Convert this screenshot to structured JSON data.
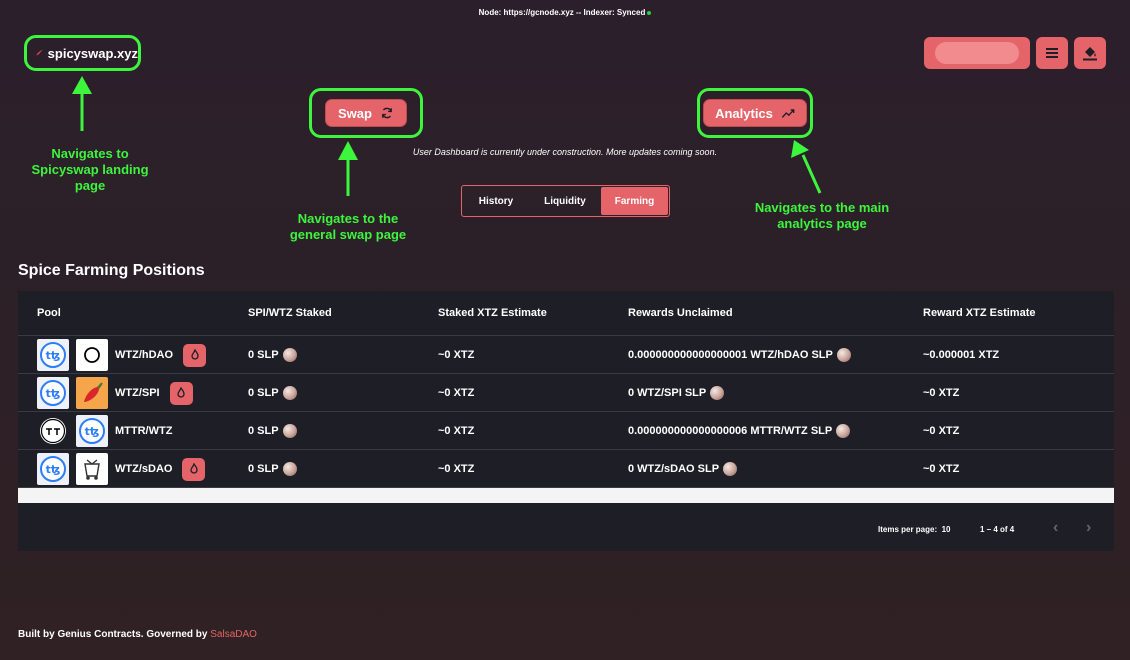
{
  "status_bar": {
    "node_text": "Node: https://gcnode.xyz  --  Indexer: Synced"
  },
  "header": {
    "logo_text": "spicyswap.xyz"
  },
  "nav": {
    "swap_label": "Swap",
    "analytics_label": "Analytics"
  },
  "notice": "User Dashboard is currently under construction. More updates coming soon.",
  "tabs": [
    {
      "label": "History"
    },
    {
      "label": "Liquidity"
    },
    {
      "label": "Farming",
      "active": true
    }
  ],
  "annotations": {
    "logo": "Navigates to Spicyswap landing page",
    "swap": "Navigates to the general swap page",
    "analytics": "Navigates to the main analytics page"
  },
  "section_title": "Spice Farming Positions",
  "table": {
    "headers": [
      "Pool",
      "SPI/WTZ Staked",
      "Staked XTZ Estimate",
      "Rewards Unclaimed",
      "Reward XTZ Estimate"
    ],
    "rows": [
      {
        "pool": "WTZ/hDAO",
        "token_a": "tezos-icon",
        "token_b": "hdao-icon",
        "staked": "0 SLP",
        "xtz_estimate": "~0 XTZ",
        "rewards": "0.000000000000000001 WTZ/hDAO SLP",
        "reward_xtz": "~0.000001 XTZ"
      },
      {
        "pool": "WTZ/SPI",
        "token_a": "tezos-icon",
        "token_b": "chili-icon",
        "staked": "0 SLP",
        "xtz_estimate": "~0 XTZ",
        "rewards": "0 WTZ/SPI SLP",
        "reward_xtz": "~0 XTZ"
      },
      {
        "pool": "MTTR/WTZ",
        "token_a": "mttr-icon",
        "token_b": "tezos-icon",
        "staked": "0 SLP",
        "xtz_estimate": "~0 XTZ",
        "rewards": "0.000000000000000006 MTTR/WTZ SLP",
        "reward_xtz": "~0 XTZ"
      },
      {
        "pool": "WTZ/sDAO",
        "token_a": "tezos-icon",
        "token_b": "sdao-icon",
        "staked": "0 SLP",
        "xtz_estimate": "~0 XTZ",
        "rewards": "0 WTZ/sDAO SLP",
        "reward_xtz": "~0 XTZ"
      }
    ]
  },
  "paginator": {
    "items_per_page_label": "Items per page:",
    "items_per_page": "10",
    "range": "1 – 4 of 4"
  },
  "footer": {
    "text": "Built by Genius Contracts. Governed by",
    "link": "SalsaDAO"
  },
  "colors": {
    "accent": "#e46469",
    "annotation": "#3cf53c",
    "table_bg": "#1e1f26"
  }
}
